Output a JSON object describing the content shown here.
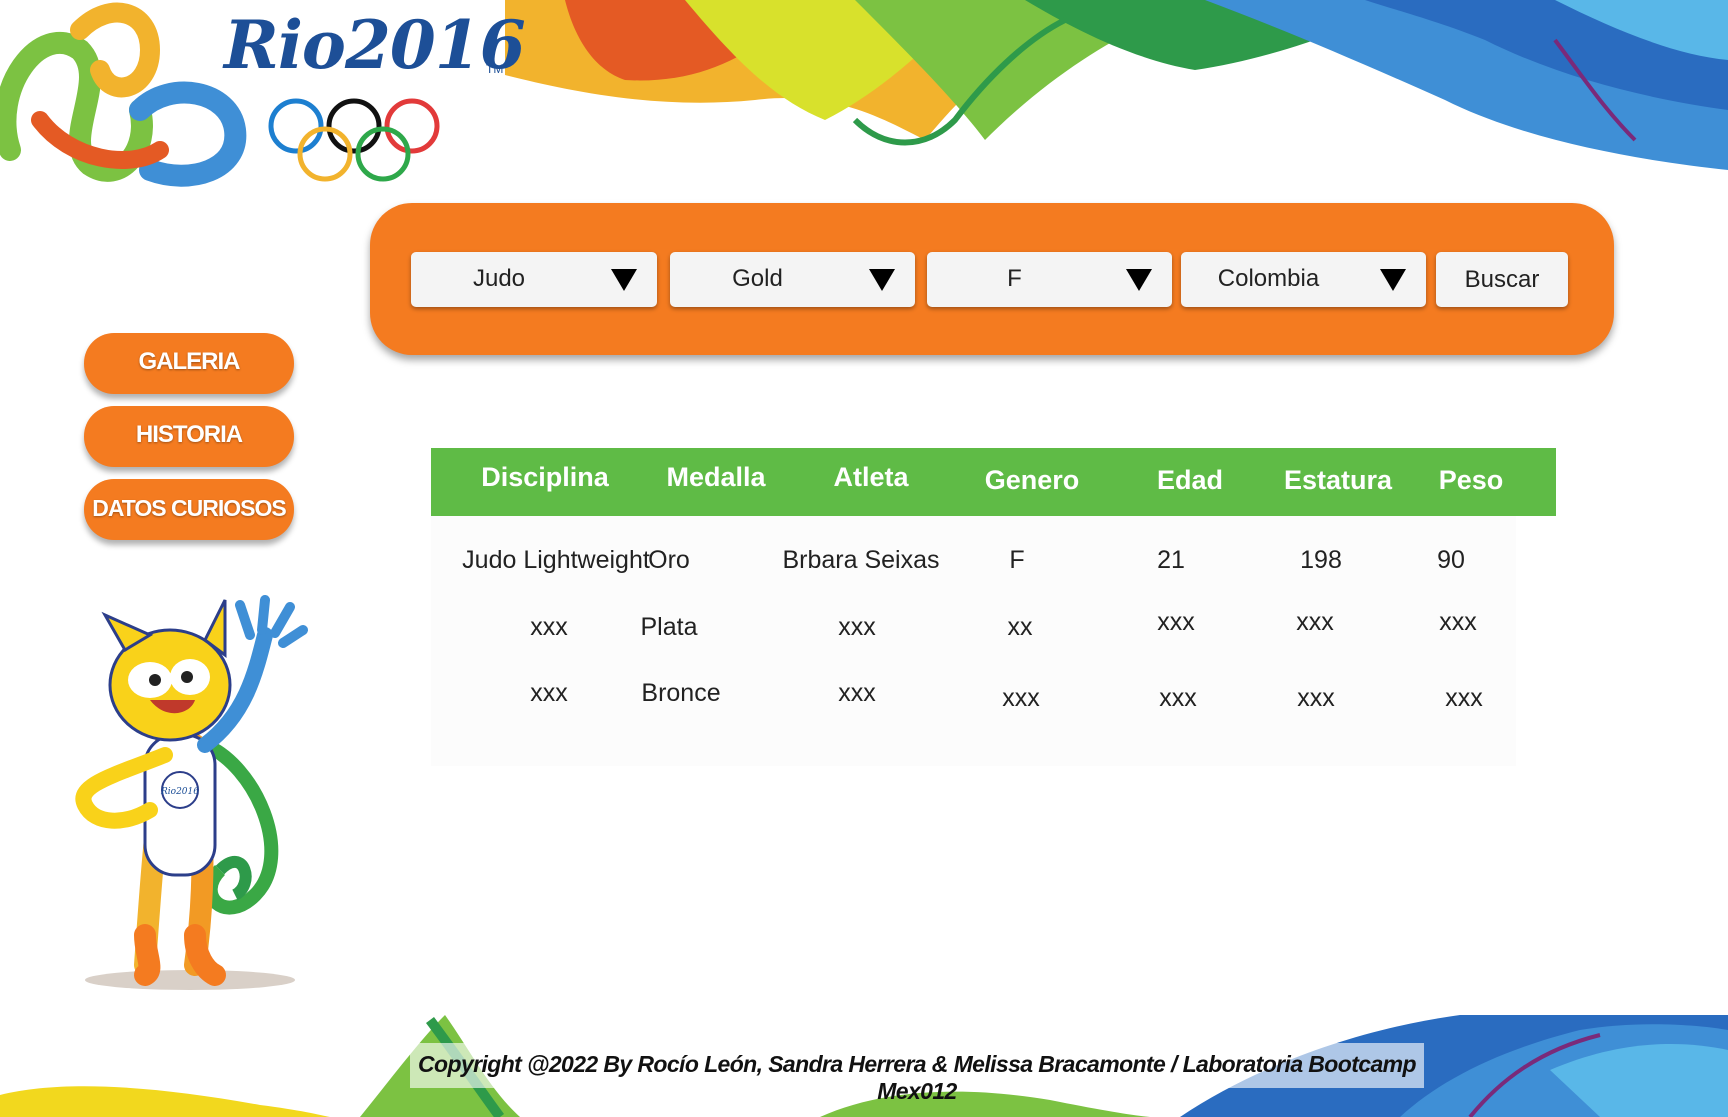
{
  "logo": {
    "wordmark": "Rio2016",
    "tm": "TM"
  },
  "filters": {
    "discipline": "Judo",
    "medal": "Gold",
    "gender": "F",
    "country": "Colombia",
    "search_label": "Buscar"
  },
  "nav": {
    "items": [
      "GALERIA",
      "HISTORIA",
      "DATOS CURIOSOS"
    ]
  },
  "mascot": {
    "badge_text": "Rio2016"
  },
  "table": {
    "headers": [
      "Disciplina",
      "Medalla",
      "Atleta",
      "Genero",
      "Edad",
      "Estatura",
      "Peso"
    ],
    "rows": [
      [
        "Judo Lightweight",
        "Oro",
        "Brbara Seixas",
        "F",
        "21",
        "198",
        "90"
      ],
      [
        "xxx",
        "Plata",
        "xxx",
        "xx",
        "xxx",
        "xxx",
        "xxx"
      ],
      [
        "xxx",
        "Bronce",
        "xxx",
        "xxx",
        "xxx",
        "xxx",
        "xxx"
      ]
    ]
  },
  "footer": {
    "text": "Copyright @2022 By Rocío León, Sandra Herrera & Melissa Bracamonte / Laboratoria Bootcamp Mex012"
  },
  "colors": {
    "accent_orange": "#f47b20",
    "table_green": "#5fbb46",
    "logo_blue": "#1d4f97"
  }
}
